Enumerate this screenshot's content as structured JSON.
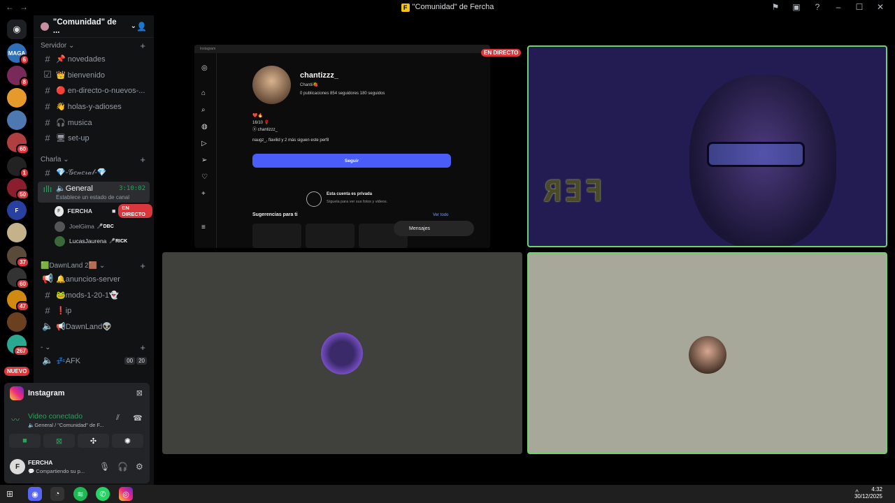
{
  "window": {
    "title": "\"Comunidad\" de Fercha",
    "badge": "F"
  },
  "guild": {
    "name": "\"Comunidad\" de ..."
  },
  "categories": {
    "servidor": "Servidor",
    "charla": "Charla",
    "dawnland": "🟩DawnLand 2🟫",
    "dash": "-"
  },
  "channels": [
    {
      "label": "📌 novedades"
    },
    {
      "label": "👑 bienvenido"
    },
    {
      "label": "🔴 en-directo-o-nuevos-..."
    },
    {
      "label": "👋 holas-y-adioses"
    },
    {
      "label": "🎧 musica"
    },
    {
      "label": "🖥 set-up"
    },
    {
      "label": "💎-𝒢𝑒𝓃𝑒𝓇𝒶𝓁-💎"
    },
    {
      "label": "🔈General",
      "sub": "Establece un estado de canal",
      "time": "3:10:02"
    },
    {
      "label": "🔔anuncios-server"
    },
    {
      "label": "🐸mods-1-20-1👻"
    },
    {
      "label": "❗ip"
    },
    {
      "label": "📢DawnLand👽"
    },
    {
      "label": "💤AFK",
      "c1": "00",
      "c2": "20"
    }
  ],
  "voice_users": [
    {
      "name": "FERCHA",
      "initial": "F",
      "live": "EN DIRECTO"
    },
    {
      "name": "JoelGima",
      "tag": "🎤DBC"
    },
    {
      "name": "LucasJaurena",
      "tag": "🎤RICK"
    }
  ],
  "rail_counts": [
    "6",
    "8",
    "60",
    "1",
    "50",
    "37",
    "60",
    "47",
    "267"
  ],
  "rail_new": "NUEVO",
  "activity": {
    "name": "Instagram"
  },
  "voice": {
    "status": "Video conectado",
    "channel": "🔈General / \"Comunidad\" de F..."
  },
  "user": {
    "name": "FERCHA",
    "initial": "F",
    "status": "💬 Compartiendo su p..."
  },
  "stream": {
    "live": "EN DIRECTO",
    "bar": "Instagram",
    "username": "chantizzz_",
    "display": "Chantii🍓",
    "stats": "0 publicaciones   854 seguidores   180 seguidos",
    "bio1": "❤️🔥",
    "bio2": "16/10 🌹",
    "bio3": "ⓐ chantizzz_",
    "followed": "naugz_, flavilid y 2 más siguen este perfil",
    "follow_btn": "Seguir",
    "private_title": "Esta cuenta es privada",
    "private_sub": "Síguela para ver sus fotos y videos.",
    "suggestions": "Sugerencias para ti",
    "see_all": "Ver todo",
    "messages": "Mensajes"
  },
  "camera": {
    "led_text": "FER"
  },
  "clock": {
    "time": "4:32",
    "date": "30/12/2025"
  },
  "colors": {
    "green": "#23a55a",
    "red": "#da373c",
    "blurple": "#4a5df9",
    "speaking": "#6fd26b"
  }
}
